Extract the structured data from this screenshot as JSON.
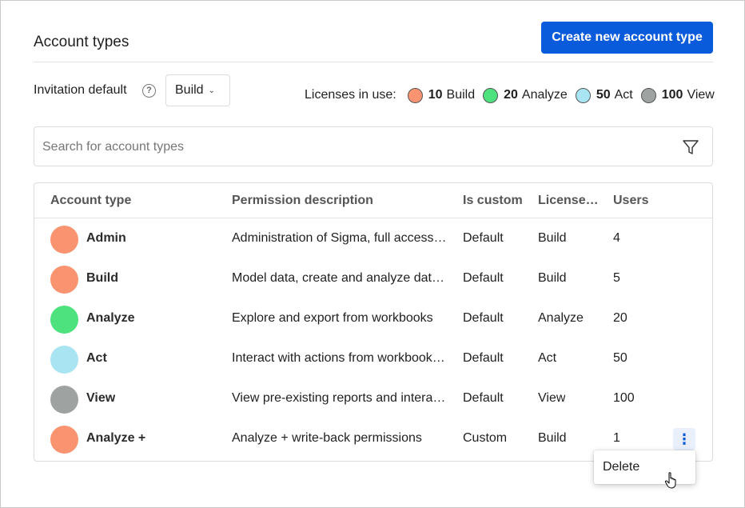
{
  "header": {
    "title": "Account types",
    "create_button": "Create new account type"
  },
  "invitation": {
    "label": "Invitation default",
    "help_icon": "?",
    "selected": "Build"
  },
  "licenses": {
    "label": "Licenses in use:",
    "items": [
      {
        "count": "10",
        "name": "Build",
        "color": "#fa9470"
      },
      {
        "count": "20",
        "name": "Analyze",
        "color": "#4ee27e"
      },
      {
        "count": "50",
        "name": "Act",
        "color": "#a9e4f2"
      },
      {
        "count": "100",
        "name": "View",
        "color": "#9ea3a1"
      }
    ]
  },
  "search": {
    "placeholder": "Search for account types",
    "value": ""
  },
  "table": {
    "columns": [
      "Account type",
      "Permission description",
      "Is custom",
      "License…",
      "Users"
    ],
    "rows": [
      {
        "name": "Admin",
        "description": "Administration of Sigma, full access to all features",
        "is_custom": "Default",
        "license": "Build",
        "users": "4",
        "color": "#fa9470"
      },
      {
        "name": "Build",
        "description": "Model data, create and analyze data in workbooks",
        "is_custom": "Default",
        "license": "Build",
        "users": "5",
        "color": "#fa9470"
      },
      {
        "name": "Analyze",
        "description": "Explore and export from workbooks",
        "is_custom": "Default",
        "license": "Analyze",
        "users": "20",
        "color": "#4ee27e"
      },
      {
        "name": "Act",
        "description": "Interact with actions from workbooks and reports",
        "is_custom": "Default",
        "license": "Act",
        "users": "50",
        "color": "#a9e4f2"
      },
      {
        "name": "View",
        "description": "View pre-existing reports and interact with data",
        "is_custom": "Default",
        "license": "View",
        "users": "100",
        "color": "#9ea3a1"
      },
      {
        "name": "Analyze +",
        "description": "Analyze + write-back permissions",
        "is_custom": "Custom",
        "license": "Build",
        "users": "1",
        "color": "#fa9470"
      }
    ],
    "row_menu_icon": "⋮"
  },
  "context_menu": {
    "items": [
      "Delete"
    ]
  },
  "colors": {
    "accent": "#0a5bdb"
  }
}
